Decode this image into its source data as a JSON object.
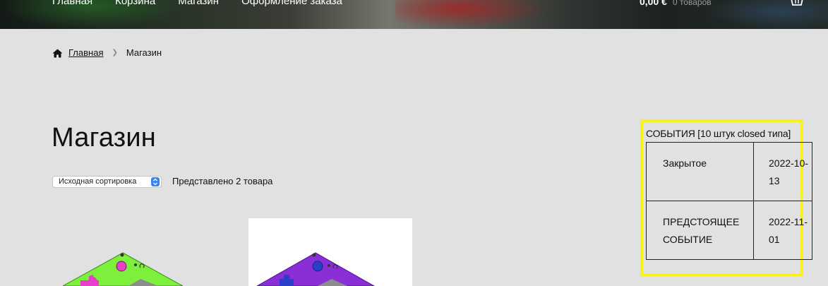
{
  "nav": {
    "items": [
      {
        "label": "Главная"
      },
      {
        "label": "Корзина"
      },
      {
        "label": "Магазин"
      },
      {
        "label": "Оформление заказа"
      }
    ]
  },
  "cart": {
    "amount": "0,00 €",
    "count": "0 товаров",
    "icon": "basket-icon"
  },
  "breadcrumb": {
    "home_icon": "home-icon",
    "home": "Главная",
    "current": "Магазин"
  },
  "page": {
    "title": "Магазин"
  },
  "shop": {
    "sort_selected": "Исходная сортировка",
    "result_count": "Представлено 2 товара"
  },
  "widget": {
    "title": "СОБЫТИЯ [10 штук closed типа]",
    "events": [
      {
        "status": "Закрытое",
        "date": "2022-10-13"
      },
      {
        "status": "ПРЕДСТОЯЩЕЕ СОБЫТИЕ",
        "date": "2022-11-01"
      }
    ]
  },
  "colors": {
    "highlight_border": "#f6f21a",
    "product_green": "#7cf03b",
    "product_purple": "#8a2fd6",
    "accent_pink": "#e83ec9"
  }
}
